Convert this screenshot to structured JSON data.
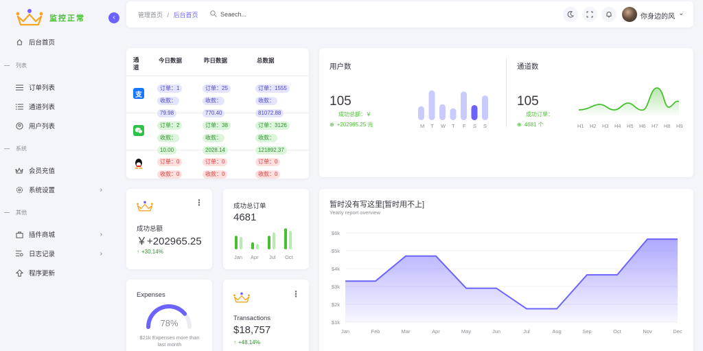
{
  "brand": {
    "name": "监控正常"
  },
  "sidebar": {
    "items": [
      {
        "label": "后台首页"
      },
      {
        "label": "订单列表"
      },
      {
        "label": "通道列表"
      },
      {
        "label": "用户列表"
      },
      {
        "label": "会员充值"
      },
      {
        "label": "系统设置"
      },
      {
        "label": "插件商城"
      },
      {
        "label": "日志记录"
      },
      {
        "label": "程序更新"
      }
    ],
    "sections": [
      "列表",
      "系统",
      "其他"
    ]
  },
  "header": {
    "breadcrumb_root": "管理首页",
    "breadcrumb_sep": "/",
    "breadcrumb_current": "后台首页",
    "search_placeholder": "Seaech...",
    "username": "你身边的风"
  },
  "channel_table": {
    "headers": [
      "通道",
      "今日数据",
      "昨日数据",
      "总数据"
    ],
    "rows": [
      {
        "icon": "alipay-icon",
        "today": [
          "订单：1",
          "收款：",
          "79.98"
        ],
        "yesterday": [
          "订单：25",
          "收款：",
          "770.40"
        ],
        "total": [
          "订单：1555",
          "收款：",
          "81072.88"
        ]
      },
      {
        "icon": "wechat-icon",
        "today": [
          "订单：2",
          "收款：",
          "10.00"
        ],
        "yesterday": [
          "订单：38",
          "收款：",
          "2028.14"
        ],
        "total": [
          "订单：3126",
          "收款：",
          "121892.37"
        ]
      },
      {
        "icon": "qq-icon",
        "today": [
          "订单：0",
          "收款：0"
        ],
        "yesterday": [
          "订单：0",
          "收款：0"
        ],
        "total": [
          "订单：0",
          "收款：0"
        ]
      }
    ]
  },
  "users_card": {
    "title": "用户数",
    "value": "105",
    "sub_label": "成功总额：￥",
    "sub_value": "+202965.25 元",
    "days": [
      "M",
      "T",
      "W",
      "T",
      "F",
      "S",
      "S"
    ],
    "bars": [
      0.35,
      0.75,
      0.4,
      0.3,
      0.72,
      0.38,
      0.62
    ],
    "highlight_index": 5
  },
  "channels_card": {
    "title": "通道数",
    "value": "105",
    "sub_label": "成功订单：",
    "sub_value": "4681 个",
    "hours": [
      "H1",
      "H2",
      "H3",
      "H4",
      "H5",
      "H6",
      "H7",
      "H8",
      "H9"
    ],
    "accent": "#47c02e"
  },
  "success_total": {
    "label": "成功总额",
    "value": "￥+202965.25",
    "change": "+30.14%"
  },
  "success_orders": {
    "label": "成功总订单",
    "value": "4681",
    "months": [
      "Jan",
      "Apr",
      "Jul",
      "Oct"
    ],
    "bars_dark": [
      0.55,
      0.28,
      0.55,
      0.85
    ],
    "bars_light": [
      0.5,
      0.22,
      0.68,
      0.75
    ]
  },
  "expenses": {
    "title": "Expenses",
    "percent": "78%",
    "value": 0.78,
    "note": "$21k Expenses more than last month"
  },
  "transactions": {
    "label": "Transactions",
    "value": "$18,757",
    "change": "+48.14%"
  },
  "report": {
    "title": "暂时没有写这里[暂时用不上]",
    "subtitle": "Yearly report overview"
  },
  "chart_data": {
    "type": "area",
    "categories": [
      "Jan",
      "Feb",
      "Mar",
      "Apr",
      "May",
      "Jun",
      "Jul",
      "Aug",
      "Sep",
      "Oct",
      "Nov",
      "Dec"
    ],
    "yticks": [
      "$1k",
      "$2k",
      "$3k",
      "$4k",
      "$5k",
      "$6k"
    ],
    "ylim": [
      1,
      6
    ],
    "series": [
      {
        "values": [
          3.3,
          3.3,
          4.7,
          4.7,
          2.9,
          2.9,
          1.75,
          1.75,
          3.65,
          3.65,
          5.65,
          5.65
        ]
      }
    ],
    "color": "#6c63ff"
  },
  "colors": {
    "accent": "#6c63ff",
    "green": "#47c02e",
    "red": "#d84040"
  }
}
